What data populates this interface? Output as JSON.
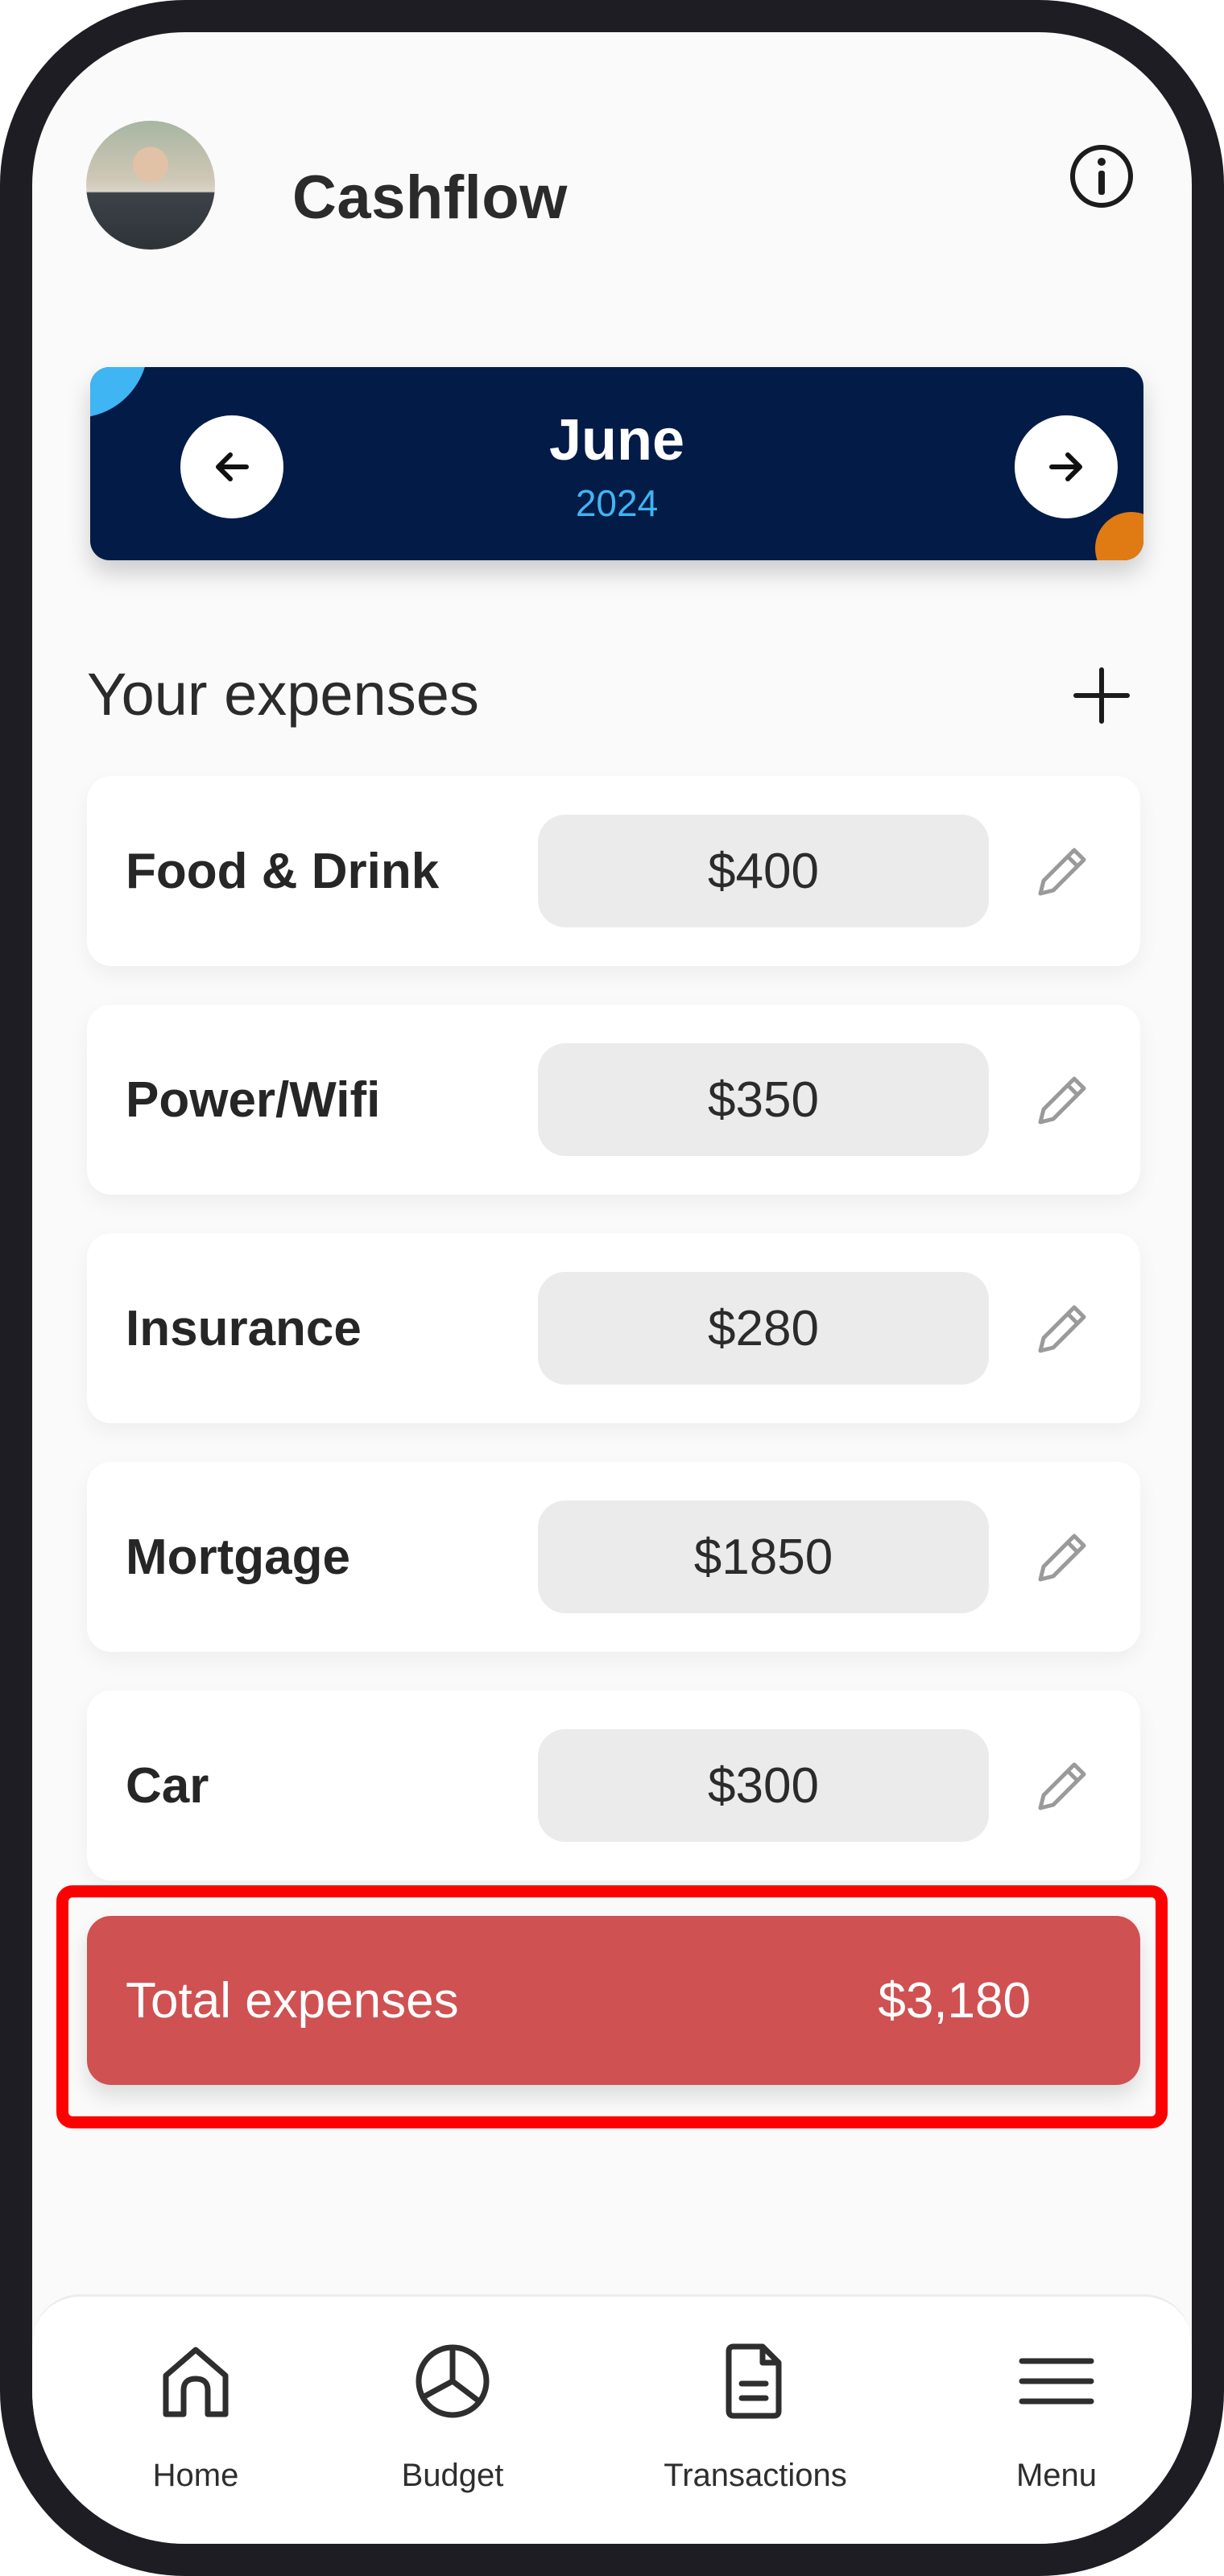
{
  "header": {
    "title": "Cashflow",
    "avatar_icon": "user-avatar",
    "info_icon": "info-icon"
  },
  "month_selector": {
    "month": "June",
    "year": "2024",
    "prev_icon": "arrow-left-icon",
    "next_icon": "arrow-right-icon",
    "colors": {
      "card": "#031b47",
      "year": "#3fb5f3",
      "accent_top": "#3fb5f3",
      "accent_bottom": "#e07a13"
    }
  },
  "expenses": {
    "title": "Your expenses",
    "add_icon": "plus-icon",
    "items": [
      {
        "label": "Food & Drink",
        "amount": "$400"
      },
      {
        "label": "Power/Wifi",
        "amount": "$350"
      },
      {
        "label": "Insurance",
        "amount": "$280"
      },
      {
        "label": "Mortgage",
        "amount": "$1850"
      },
      {
        "label": "Car",
        "amount": "$300"
      }
    ],
    "edit_icon": "pencil-icon"
  },
  "total": {
    "label": "Total expenses",
    "value": "$3,180",
    "color": "#d05152",
    "highlight_color": "#fe0000"
  },
  "bottom_nav": {
    "items": [
      {
        "label": "Home",
        "icon": "home-icon"
      },
      {
        "label": "Budget",
        "icon": "pie-chart-icon"
      },
      {
        "label": "Transactions",
        "icon": "document-icon"
      },
      {
        "label": "Menu",
        "icon": "hamburger-menu-icon"
      }
    ]
  }
}
